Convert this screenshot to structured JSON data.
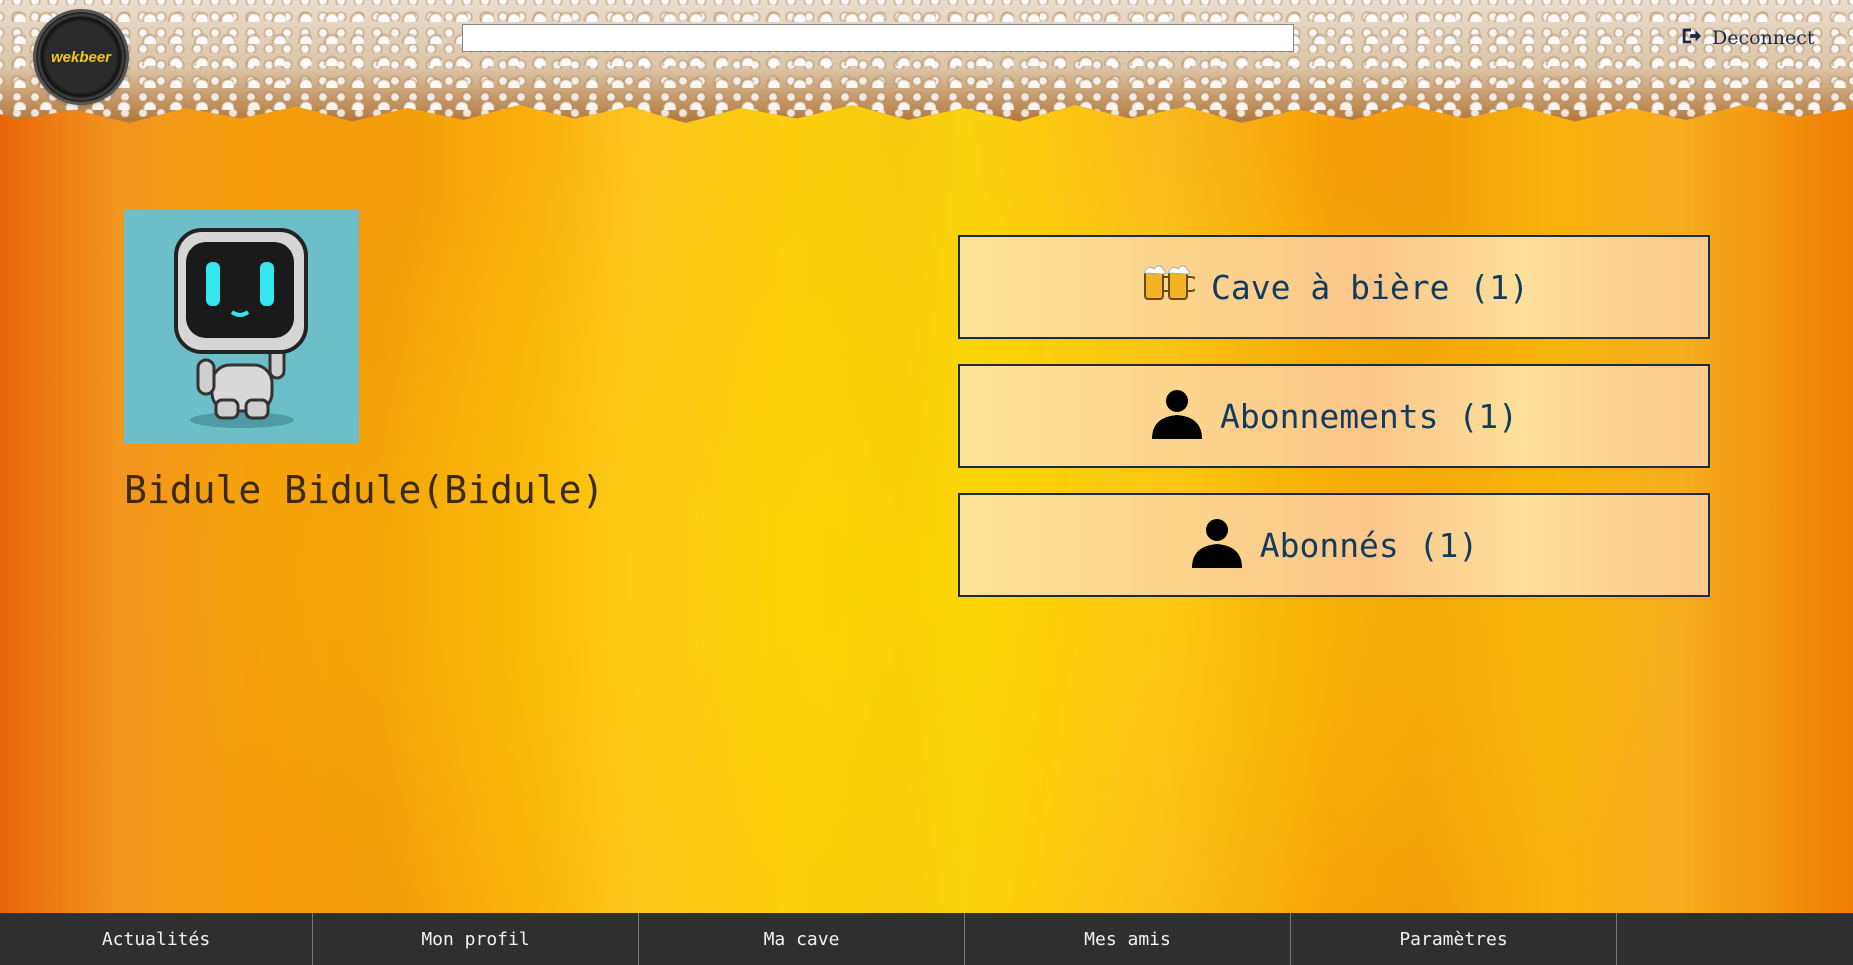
{
  "header": {
    "logo_text": "wekbeer",
    "search": {
      "value": "",
      "placeholder": ""
    },
    "logout_label": "Deconnect"
  },
  "profile": {
    "name": "Bidule Bidule(Bidule)"
  },
  "stats": {
    "cave": "Cave à bière (1)",
    "abonnements": "Abonnements (1)",
    "abonnes": "Abonnés (1)"
  },
  "nav": {
    "items": [
      "Actualités",
      "Mon profil",
      "Ma cave",
      "Mes amis",
      "Paramètres"
    ]
  },
  "colors": {
    "accent_text": "#123c5f",
    "nav_bg": "#2f2f2f",
    "button_border": "#1b2a4a"
  },
  "icons": {
    "logout": "logout-icon",
    "cave": "beer-mugs-icon",
    "abonnements": "person-icon",
    "abonnes": "person-icon"
  }
}
